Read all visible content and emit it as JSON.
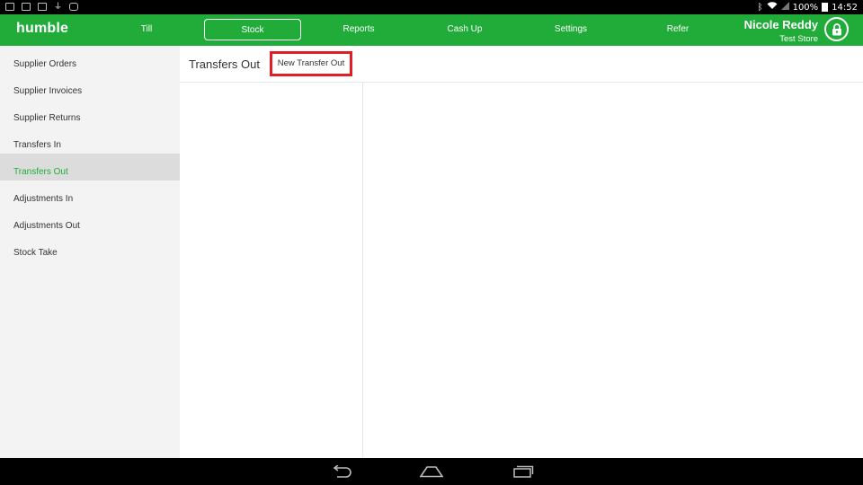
{
  "status_bar": {
    "battery": "100%",
    "time": "14:52",
    "left_icons": [
      "youtube-icon",
      "image-icon",
      "cassette-icon",
      "usb-icon",
      "game-controller-icon"
    ]
  },
  "app": {
    "logo": "humble",
    "brand_color": "#21ac3a",
    "nav": [
      {
        "label": "Till"
      },
      {
        "label": "Stock",
        "active": true
      },
      {
        "label": "Reports"
      },
      {
        "label": "Cash Up"
      },
      {
        "label": "Settings"
      },
      {
        "label": "Refer"
      }
    ],
    "user": {
      "name": "Nicole Reddy",
      "store": "Test Store"
    }
  },
  "sidebar": {
    "items": [
      {
        "label": "Supplier Orders"
      },
      {
        "label": "Supplier Invoices"
      },
      {
        "label": "Supplier Returns"
      },
      {
        "label": "Transfers In"
      },
      {
        "label": "Transfers Out",
        "active": true
      },
      {
        "label": "Adjustments In"
      },
      {
        "label": "Adjustments Out"
      },
      {
        "label": "Stock Take"
      }
    ]
  },
  "main": {
    "title": "Transfers Out",
    "new_button": "New Transfer Out",
    "highlight_color": "#e31d25"
  }
}
